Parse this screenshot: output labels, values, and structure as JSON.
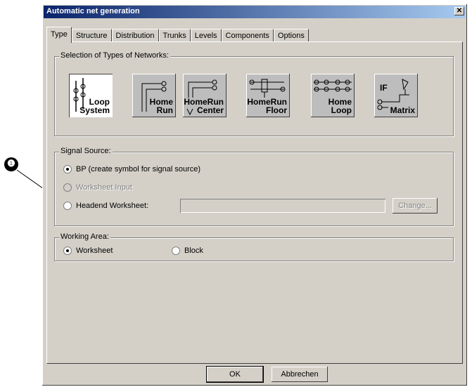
{
  "callout": {
    "number": "❶"
  },
  "dialog": {
    "title": "Automatic net generation",
    "close_glyph": "✕"
  },
  "tabs": [
    {
      "label": "Type",
      "active": true
    },
    {
      "label": "Structure"
    },
    {
      "label": "Distribution"
    },
    {
      "label": "Trunks"
    },
    {
      "label": "Levels"
    },
    {
      "label": "Components"
    },
    {
      "label": "Options"
    }
  ],
  "network_types": {
    "title": "Selection of Types of Networks:",
    "items": [
      {
        "line1": "Loop",
        "line2": "System",
        "selected": true
      },
      {
        "line1": "Home",
        "line2": "Run"
      },
      {
        "line1": "HomeRun",
        "line2": "Center"
      },
      {
        "line1": "HomeRun",
        "line2": "Floor"
      },
      {
        "line1": "Home",
        "line2": "Loop"
      },
      {
        "line1": "IF",
        "line2": "Matrix"
      }
    ]
  },
  "signal_source": {
    "title": "Signal Source:",
    "bp_label": "BP (create symbol for signal source)",
    "worksheet_input_label": "Worksheet Input",
    "headend_label": "Headend Worksheet:",
    "headend_value": "",
    "change_label": "Change..."
  },
  "working_area": {
    "title": "Working Area:",
    "worksheet_label": "Worksheet",
    "block_label": "Block"
  },
  "footer": {
    "ok_label": "OK",
    "cancel_label": "Abbrechen"
  }
}
